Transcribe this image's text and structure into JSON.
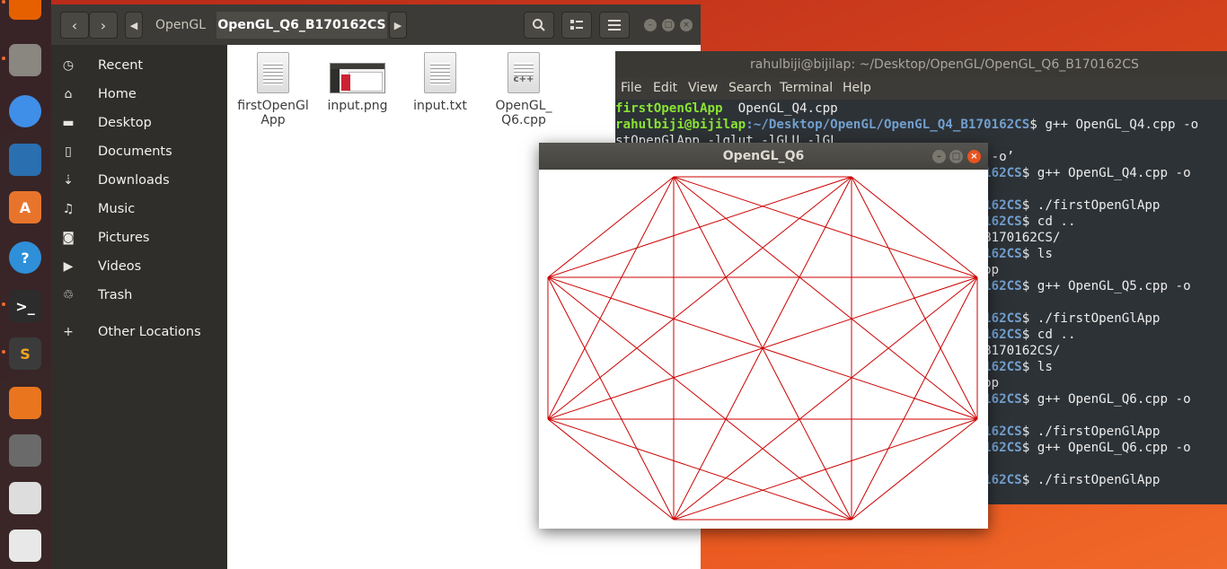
{
  "launcher": {
    "items": [
      {
        "name": "firefox-icon",
        "color": "#e66000",
        "glyph": ""
      },
      {
        "name": "files-icon",
        "color": "#8a8680",
        "glyph": ""
      },
      {
        "name": "chrome-icon",
        "color": "#3f8ee8",
        "glyph": ""
      },
      {
        "name": "writer-icon",
        "color": "#2a6fb0",
        "glyph": ""
      },
      {
        "name": "software-icon",
        "color": "#e8742c",
        "glyph": "A"
      },
      {
        "name": "help-icon",
        "color": "#2f8fd8",
        "glyph": "?"
      },
      {
        "name": "terminal-icon",
        "color": "#2c2c2c",
        "glyph": ">_"
      },
      {
        "name": "sublime-icon",
        "color": "#3b3b3b",
        "glyph": "S"
      },
      {
        "name": "vlc-icon",
        "color": "#e9761e",
        "glyph": ""
      },
      {
        "name": "calculator-icon",
        "color": "#6a6a6a",
        "glyph": ""
      },
      {
        "name": "text-editor-icon",
        "color": "#dddddd",
        "glyph": ""
      },
      {
        "name": "pdf-viewer-icon",
        "color": "#e8e8e8",
        "glyph": ""
      }
    ]
  },
  "files": {
    "breadcrumbs": [
      "OpenGL",
      "OpenGL_Q6_B170162CS"
    ],
    "sidebar": [
      {
        "label": "Recent",
        "icon": "clock-icon"
      },
      {
        "label": "Home",
        "icon": "home-icon"
      },
      {
        "label": "Desktop",
        "icon": "folder-icon"
      },
      {
        "label": "Documents",
        "icon": "document-icon"
      },
      {
        "label": "Downloads",
        "icon": "download-icon"
      },
      {
        "label": "Music",
        "icon": "music-icon"
      },
      {
        "label": "Pictures",
        "icon": "camera-icon"
      },
      {
        "label": "Videos",
        "icon": "video-icon"
      },
      {
        "label": "Trash",
        "icon": "trash-icon"
      },
      {
        "label": "Other Locations",
        "icon": "plus-icon"
      }
    ],
    "items": [
      {
        "name_line1": "firstOpenGl",
        "name_line2": "App",
        "type": "binary"
      },
      {
        "name_line1": "input.png",
        "name_line2": "",
        "type": "image"
      },
      {
        "name_line1": "input.txt",
        "name_line2": "",
        "type": "text"
      },
      {
        "name_line1": "OpenGL_",
        "name_line2": "Q6.cpp",
        "type": "cpp",
        "badge": "c++"
      }
    ]
  },
  "terminal": {
    "title": "rahulbiji@bijilap: ~/Desktop/OpenGL/OpenGL_Q6_B170162CS",
    "menu": [
      "File",
      "Edit",
      "View",
      "Search",
      "Terminal",
      "Help"
    ],
    "lines": [
      {
        "g": "firstOpenGlApp",
        "b": "",
        "t": "  OpenGL_Q4.cpp"
      },
      {
        "g": "rahulbiji@bijilap",
        "b": ":~/Desktop/OpenGL/OpenGL_Q4_B170162CS",
        "t": "$ g++ OpenGL_Q4.cpp -o"
      },
      {
        "g": "",
        "b": "",
        "t": "stOpenGlApp -lglut -lGLU -lGL"
      },
      {
        "g": "",
        "b": "",
        "t": "                                                 -o’"
      },
      {
        "g": "",
        "b": "                                             170162CS",
        "t": "$ g++ OpenGL_Q4.cpp -o"
      },
      {
        "g": "",
        "b": "",
        "t": ""
      },
      {
        "g": "",
        "b": "                                             170162CS",
        "t": "$ ./firstOpenGlApp"
      },
      {
        "g": "",
        "b": "                                             170162CS",
        "t": "$ cd .."
      },
      {
        "g": "",
        "b": "",
        "t": "                                             Q5_B170162CS/"
      },
      {
        "g": "",
        "b": "                                             170162CS",
        "t": "$ ls"
      },
      {
        "g": "",
        "b": "",
        "t": "                                             5.cpp"
      },
      {
        "g": "",
        "b": "                                             170162CS",
        "t": "$ g++ OpenGL_Q5.cpp -o"
      },
      {
        "g": "",
        "b": "",
        "t": ""
      },
      {
        "g": "",
        "b": "                                             170162CS",
        "t": "$ ./firstOpenGlApp"
      },
      {
        "g": "",
        "b": "                                             170162CS",
        "t": "$ cd .."
      },
      {
        "g": "",
        "b": "",
        "t": "                                             Q6_B170162CS/"
      },
      {
        "g": "",
        "b": "                                             170162CS",
        "t": "$ ls"
      },
      {
        "g": "",
        "b": "",
        "t": "                                             6.cpp"
      },
      {
        "g": "",
        "b": "                                             170162CS",
        "t": "$ g++ OpenGL_Q6.cpp -o"
      },
      {
        "g": "",
        "b": "",
        "t": ""
      },
      {
        "g": "",
        "b": "                                             170162CS",
        "t": "$ ./firstOpenGlApp"
      },
      {
        "g": "",
        "b": "                                             170162CS",
        "t": "$ g++ OpenGL_Q6.cpp -o"
      },
      {
        "g": "",
        "b": "",
        "t": ""
      },
      {
        "g": "",
        "b": "                                             170162CS",
        "t": "$ ./firstOpenGlApp"
      }
    ]
  },
  "gl_window": {
    "title": "OpenGL_Q6",
    "line_color": "#cc0000",
    "vertex_count": 8
  }
}
